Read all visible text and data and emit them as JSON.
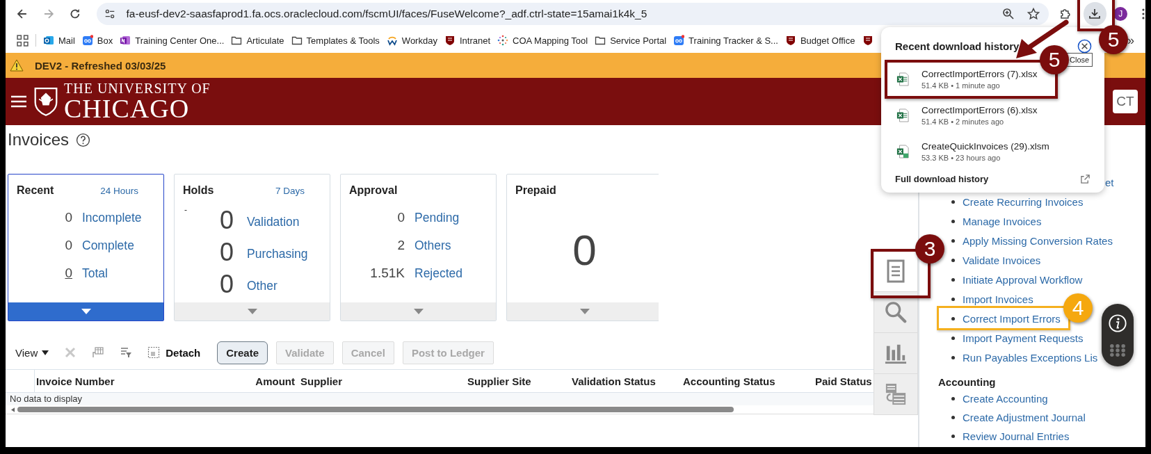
{
  "browser": {
    "url": "fa-eusf-dev2-saasfaprod1.fa.ocs.oraclecloud.com/fscmUI/faces/FuseWelcome?_adf.ctrl-state=15amai1k4k_5",
    "profile": "J",
    "overflow": "»",
    "bookmarks": [
      {
        "label": "Mail",
        "kind": "outlook"
      },
      {
        "label": "Box",
        "kind": "box"
      },
      {
        "label": "Training Center One...",
        "kind": "onenote"
      },
      {
        "label": "Articulate",
        "kind": "folder"
      },
      {
        "label": "Templates & Tools",
        "kind": "folder"
      },
      {
        "label": "Workday",
        "kind": "workday"
      },
      {
        "label": "Intranet",
        "kind": "shield"
      },
      {
        "label": "COA Mapping Tool",
        "kind": "dots"
      },
      {
        "label": "Service Portal",
        "kind": "folder"
      },
      {
        "label": "Training Tracker & S...",
        "kind": "box"
      },
      {
        "label": "Budget Office",
        "kind": "shield"
      }
    ]
  },
  "env_banner": "DEV2 - Refreshed 03/03/25",
  "header": {
    "logo_top": "THE UNIVERSITY OF",
    "logo_bottom": "CHICAGO",
    "user": "CT"
  },
  "page_title": "Invoices",
  "tiles": [
    {
      "title": "Recent",
      "period": "24 Hours",
      "kind": "list",
      "selected": true,
      "rows": [
        {
          "value": "0",
          "label": "Incomplete",
          "underlined": false
        },
        {
          "value": "0",
          "label": "Complete",
          "underlined": false
        },
        {
          "value": "0",
          "label": "Total",
          "underlined": true
        }
      ]
    },
    {
      "title": "Holds",
      "period": "7 Days",
      "note": "-",
      "kind": "large",
      "selected": false,
      "rows": [
        {
          "value": "0",
          "label": "Validation"
        },
        {
          "value": "0",
          "label": "Purchasing"
        },
        {
          "value": "0",
          "label": "Other"
        }
      ]
    },
    {
      "title": "Approval",
      "kind": "list",
      "selected": false,
      "rows": [
        {
          "value": "0",
          "label": "Pending"
        },
        {
          "value": "2",
          "label": "Others"
        },
        {
          "value": "1.51K",
          "label": "Rejected"
        }
      ]
    },
    {
      "title": "Prepaid",
      "kind": "single",
      "selected": false,
      "value": "0"
    }
  ],
  "toolbar": {
    "view": "View",
    "detach": "Detach",
    "buttons": [
      {
        "label": "Create",
        "disabled": false
      },
      {
        "label": "Validate",
        "disabled": true
      },
      {
        "label": "Cancel",
        "disabled": true
      },
      {
        "label": "Post to Ledger",
        "disabled": true
      }
    ]
  },
  "table": {
    "columns": [
      "Invoice Number",
      "Amount",
      "Supplier",
      "Supplier Site",
      "Validation Status",
      "Accounting Status",
      "Paid Status"
    ],
    "empty_message": "No data to display"
  },
  "side_icons": [
    {
      "kind": "document",
      "selected": true
    },
    {
      "kind": "search",
      "selected": false
    },
    {
      "kind": "chart",
      "selected": false
    },
    {
      "kind": "report",
      "selected": false
    }
  ],
  "panel": {
    "links": [
      {
        "label": "et",
        "kind": "fragment"
      },
      {
        "label": "Create Recurring Invoices",
        "kind": "link"
      },
      {
        "label": "Manage Invoices",
        "kind": "link"
      },
      {
        "label": "Apply Missing Conversion Rates",
        "kind": "link"
      },
      {
        "label": "Validate Invoices",
        "kind": "link"
      },
      {
        "label": "Initiate Approval Workflow",
        "kind": "link"
      },
      {
        "label": "Import Invoices",
        "kind": "link"
      },
      {
        "label": "Correct Import Errors",
        "kind": "link"
      },
      {
        "label": "Import Payment Requests",
        "kind": "link"
      },
      {
        "label": "Run Payables Exceptions Lis",
        "kind": "link"
      }
    ],
    "sections": [
      {
        "heading": "Accounting",
        "links": [
          "Create Accounting",
          "Create Adjustment Journal",
          "Review Journal Entries"
        ]
      }
    ]
  },
  "downloads": {
    "title": "Recent download history",
    "items": [
      {
        "name": "CorrectImportErrors (7).xlsx",
        "meta": "51.4 KB • 1 minute ago",
        "kind": "xlsx"
      },
      {
        "name": "CorrectImportErrors (6).xlsx",
        "meta": "51.4 KB • 2 minutes ago",
        "kind": "xlsx"
      },
      {
        "name": "CreateQuickInvoices (29).xlsm",
        "meta": "53.3 KB • 23 hours ago",
        "kind": "xlsm"
      }
    ],
    "footer": "Full download history",
    "tooltip": "Close"
  },
  "callouts": [
    {
      "number": "5",
      "kind": "maroon"
    },
    {
      "number": "5",
      "kind": "maroon"
    },
    {
      "number": "3",
      "kind": "maroon"
    },
    {
      "number": "4",
      "kind": "orange"
    }
  ]
}
